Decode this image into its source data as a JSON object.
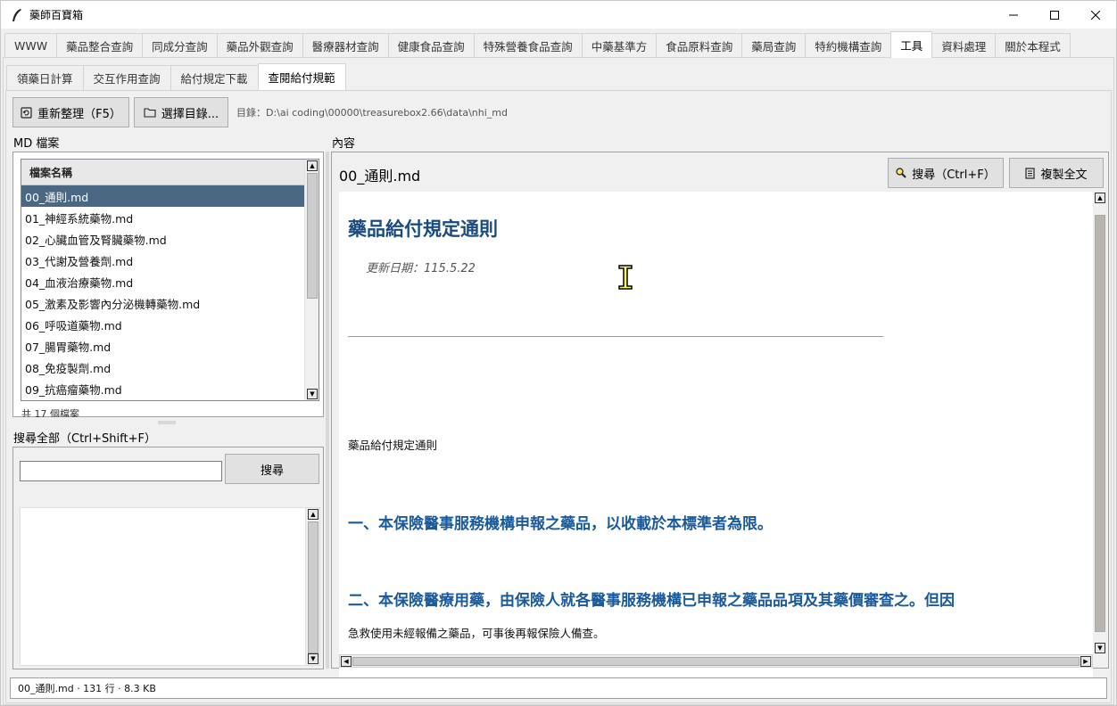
{
  "window": {
    "title": "藥師百寶箱"
  },
  "main_tabs": [
    {
      "label": "WWW"
    },
    {
      "label": "藥品整合查詢"
    },
    {
      "label": "同成分查詢"
    },
    {
      "label": "藥品外觀查詢"
    },
    {
      "label": "醫療器材查詢"
    },
    {
      "label": "健康食品查詢"
    },
    {
      "label": "特殊營養食品查詢"
    },
    {
      "label": "中藥基準方"
    },
    {
      "label": "食品原料查詢"
    },
    {
      "label": "藥局查詢"
    },
    {
      "label": "特約機構查詢"
    },
    {
      "label": "工具"
    },
    {
      "label": "資料處理"
    },
    {
      "label": "關於本程式"
    }
  ],
  "sub_tabs": [
    {
      "label": "領藥日計算"
    },
    {
      "label": "交互作用查詢"
    },
    {
      "label": "給付規定下載"
    },
    {
      "label": "查閱給付規範"
    }
  ],
  "toolbar": {
    "refresh_label": "重新整理（F5）",
    "choose_dir_label": "選擇目錄...",
    "dir_path": "目錄：D:\\ai coding\\00000\\treasurebox2.66\\data\\nhi_md"
  },
  "file_panel": {
    "section_label": "MD 檔案",
    "column_header": "檔案名稱",
    "files": [
      "00_通則.md",
      "01_神經系統藥物.md",
      "02_心臟血管及腎臟藥物.md",
      "03_代謝及營養劑.md",
      "04_血液治療藥物.md",
      "05_激素及影響內分泌機轉藥物.md",
      "06_呼吸道藥物.md",
      "07_腸胃藥物.md",
      "08_免疫製劑.md",
      "09_抗癌瘤藥物.md"
    ],
    "selected_index": 0,
    "count_text": "共 17 個檔案"
  },
  "search_panel": {
    "section_label": "搜尋全部（Ctrl+Shift+F）",
    "input_value": "",
    "search_button": "搜尋"
  },
  "content_panel": {
    "section_label": "內容",
    "file_title": "00_通則.md",
    "search_button": "搜尋（Ctrl+F）",
    "copy_button": "複製全文",
    "doc": {
      "heading": "藥品給付規定通則",
      "date": "更新日期：115.5.22",
      "para1": "藥品給付規定通則",
      "item1": "一、本保險醫事服務機構申報之藥品，以收載於本標準者為限。",
      "item2": "二、本保險醫療用藥，由保險人就各醫事服務機構已申報之藥品品項及其藥價審查之。但因",
      "para2": "急救使用未經報備之藥品，可事後再報保險人備查。"
    }
  },
  "statusbar": {
    "text": "00_通則.md · 131 行 · 8.3 KB"
  },
  "colors": {
    "selected_row": "#4a6883",
    "heading": "#1a4b80",
    "subheading": "#1a5a9a"
  },
  "icons": [
    "feather-icon",
    "minimize-icon",
    "maximize-icon",
    "close-icon",
    "refresh-icon",
    "folder-icon",
    "search-icon",
    "copy-icon",
    "text-cursor-icon"
  ]
}
